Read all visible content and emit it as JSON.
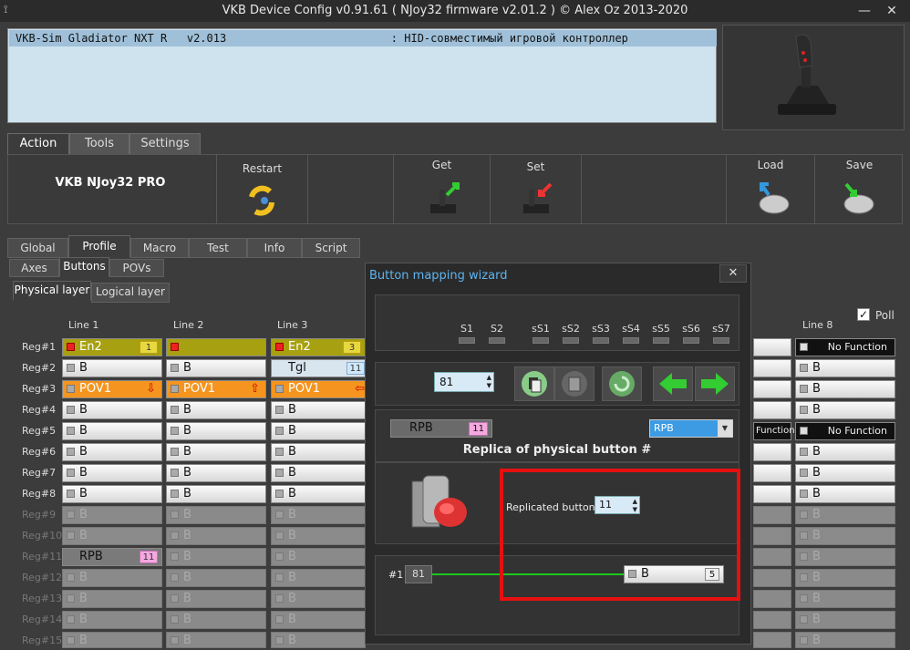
{
  "window": {
    "title": "VKB Device Config v0.91.61 ( NJoy32 firmware v2.01.2 ) © Alex Oz 2013-2020",
    "minimize": "—",
    "close": "✕"
  },
  "device_row": "VKB-Sim Gladiator NXT R   v2.013                         : HID-совместимый игровой контроллер",
  "main_tabs": [
    "Action",
    "Tools",
    "Settings"
  ],
  "ribbon": {
    "brand": "VKB NJoy32 PRO",
    "restart": "Restart",
    "get": "Get",
    "set": "Set",
    "load": "Load",
    "save": "Save"
  },
  "profile_tabs": [
    "Global",
    "Profile",
    "Macro",
    "Test",
    "Info",
    "Script"
  ],
  "sub_tabs": [
    "Axes",
    "Buttons",
    "POVs"
  ],
  "layer_tabs": [
    "Physical layer",
    "Logical layer"
  ],
  "poll": "Poll",
  "columns": [
    "Line 1",
    "Line 2",
    "Line 3",
    "Line 8"
  ],
  "regs": [
    "Reg#1",
    "Reg#2",
    "Reg#3",
    "Reg#4",
    "Reg#5",
    "Reg#6",
    "Reg#7",
    "Reg#8",
    "Reg#9",
    "Reg#10",
    "Reg#11",
    "Reg#12",
    "Reg#13",
    "Reg#14",
    "Reg#15"
  ],
  "cells": {
    "en2": "En2",
    "en2_num1": "1",
    "en2_num3": "3",
    "b": "B",
    "tgl": "Tgl",
    "tgl_num": "11",
    "pov": "POV1",
    "rpb": "RPB",
    "rpb_num": "11",
    "no_function": "No Function",
    "function_partial": "Function"
  },
  "wizard": {
    "title": "Button mapping wizard",
    "close": "✕",
    "shifts": [
      "S1",
      "S2",
      "sS1",
      "sS2",
      "sS3",
      "sS4",
      "sS5",
      "sS6",
      "sS7"
    ],
    "button_num": "81",
    "type_label": "RPB",
    "type_num": "11",
    "type_select": "RPB",
    "heading": "Replica of physical button #",
    "replicated_label": "Replicated button",
    "replicated_value": "11",
    "chain_prefix": "#1",
    "chain_num": "81",
    "out_label": "B",
    "out_num": "5"
  }
}
